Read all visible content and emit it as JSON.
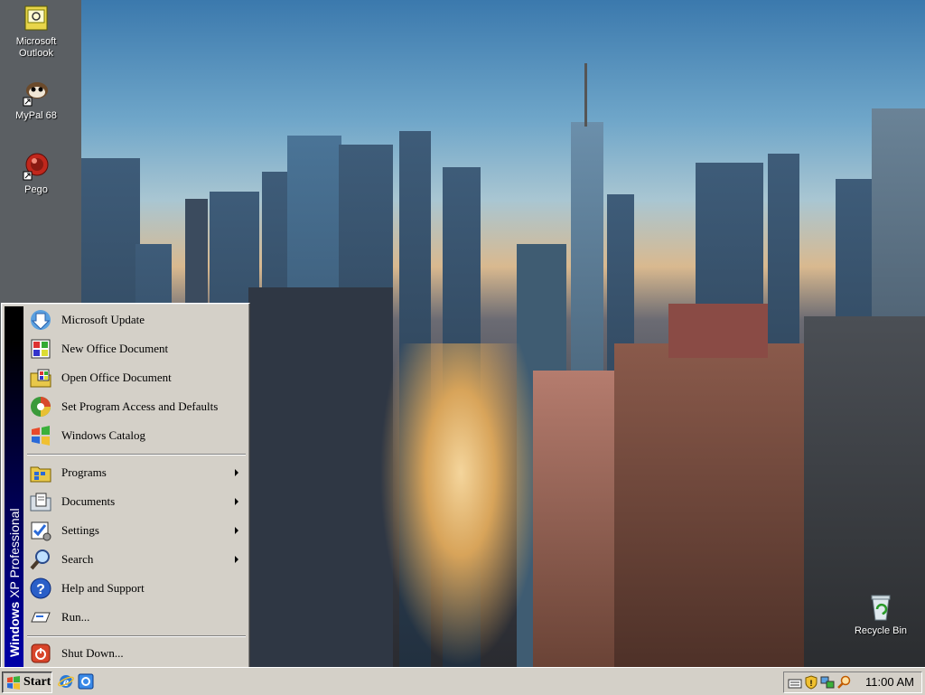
{
  "desktop": {
    "icons": [
      {
        "label_line1": "Microsoft",
        "label_line2": "Outlook",
        "icon": "outlook-icon"
      },
      {
        "label_line1": "MyPal 68",
        "label_line2": "",
        "icon": "mypal-icon"
      },
      {
        "label_line1": "Pego",
        "label_line2": "",
        "icon": "pego-icon"
      },
      {
        "label_line1": "Recycle Bin",
        "label_line2": "",
        "icon": "recycle-bin-icon"
      }
    ]
  },
  "start_menu": {
    "banner": {
      "brand": "Windows",
      "edition": "XP Professional"
    },
    "top_items": [
      {
        "label": "Microsoft Update",
        "icon": "windows-update-icon"
      },
      {
        "label": "New Office Document",
        "icon": "new-office-document-icon"
      },
      {
        "label": "Open Office Document",
        "icon": "open-office-document-icon"
      },
      {
        "label": "Set Program Access and Defaults",
        "icon": "program-access-icon"
      },
      {
        "label": "Windows Catalog",
        "icon": "windows-catalog-icon"
      }
    ],
    "main_items": [
      {
        "label": "Programs",
        "icon": "programs-folder-icon",
        "submenu": true
      },
      {
        "label": "Documents",
        "icon": "documents-icon",
        "submenu": true
      },
      {
        "label": "Settings",
        "icon": "settings-icon",
        "submenu": true
      },
      {
        "label": "Search",
        "icon": "search-icon",
        "submenu": true
      },
      {
        "label": "Help and Support",
        "icon": "help-icon",
        "submenu": false
      },
      {
        "label": "Run...",
        "icon": "run-icon",
        "submenu": false
      }
    ],
    "shutdown": {
      "label": "Shut Down...",
      "icon": "shutdown-icon"
    }
  },
  "taskbar": {
    "start_label": "Start",
    "quick_launch": [
      "internet-explorer-icon",
      "browser-icon"
    ],
    "tray_icons": [
      "keyboard-icon",
      "security-shield-icon",
      "network-icon",
      "search-tray-icon"
    ],
    "clock": "11:00 AM"
  },
  "colors": {
    "menu_bg": "#d4d0c8",
    "banner_top": "#000000",
    "banner_bottom": "#0000a8"
  }
}
